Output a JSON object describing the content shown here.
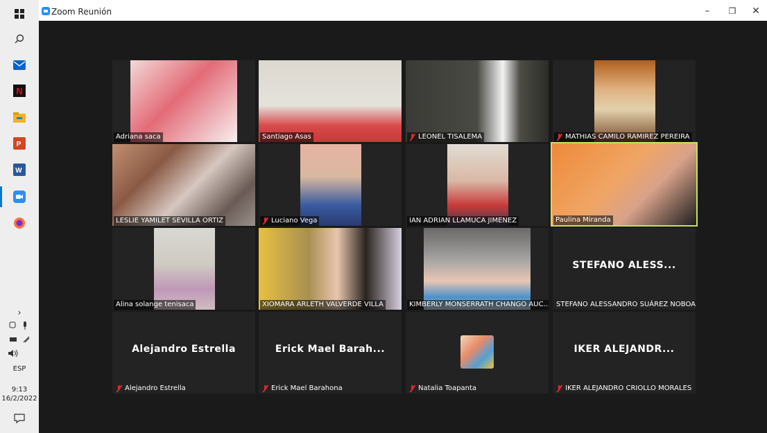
{
  "window": {
    "title": "Zoom Reunión",
    "controls": [
      "–",
      "❐",
      "✕"
    ]
  },
  "taskbar": {
    "icons": [
      "windows-start-icon",
      "search-icon",
      "mail-icon",
      "netflix-icon",
      "file-explorer-icon",
      "powerpoint-icon",
      "word-icon",
      "zoom-icon",
      "firefox-icon"
    ],
    "tray": {
      "language": "ESP",
      "time": "9:13",
      "date": "16/2/2022"
    }
  },
  "participants": [
    {
      "name": "Adriana saca",
      "muted": false,
      "video": true
    },
    {
      "name": "Santiago Asas",
      "muted": false,
      "video": true
    },
    {
      "name": "LEONEL  TISALEMA",
      "muted": true,
      "video": true
    },
    {
      "name": "MATHIAS CAMILO RAMIREZ PEREIRA",
      "muted": true,
      "video": true
    },
    {
      "name": "LESLIE YAMILET SEVILLA ORTIZ",
      "muted": false,
      "video": true
    },
    {
      "name": "Luciano Vega",
      "muted": true,
      "video": true
    },
    {
      "name": "IAN ADRIAN LLAMUCA JIMENEZ",
      "muted": false,
      "video": true
    },
    {
      "name": "Paulina Miranda",
      "muted": false,
      "video": true,
      "speaking": true
    },
    {
      "name": "Alina solange  tenisaca",
      "muted": false,
      "video": true
    },
    {
      "name": "XIOMARA ARLETH VALVERDE VILLA",
      "muted": false,
      "video": true
    },
    {
      "name": "KIMBERLY MONSERRATH CHANGO AUC...",
      "muted": false,
      "video": true
    },
    {
      "name": "STEFANO ALESSANDRO SUÁREZ NOBOA",
      "display_name": "STEFANO  ALESS...",
      "muted": false,
      "video": false
    },
    {
      "name": "Alejandro Estrella",
      "display_name": "Alejandro Estrella",
      "muted": true,
      "video": false
    },
    {
      "name": "Erick Mael Barahona",
      "display_name": "Erick Mael Barah...",
      "muted": true,
      "video": false
    },
    {
      "name": "Natalia Toapanta",
      "muted": true,
      "video": false,
      "avatar": true
    },
    {
      "name": "IKER ALEJANDRO CRIOLLO MORALES",
      "display_name": "IKER  ALEJANDR...",
      "muted": true,
      "video": false
    }
  ],
  "colors": {
    "speaking_border": "#c8e05c",
    "mute_red": "#e02828",
    "background": "#1a1a1a",
    "tile": "#232323"
  }
}
